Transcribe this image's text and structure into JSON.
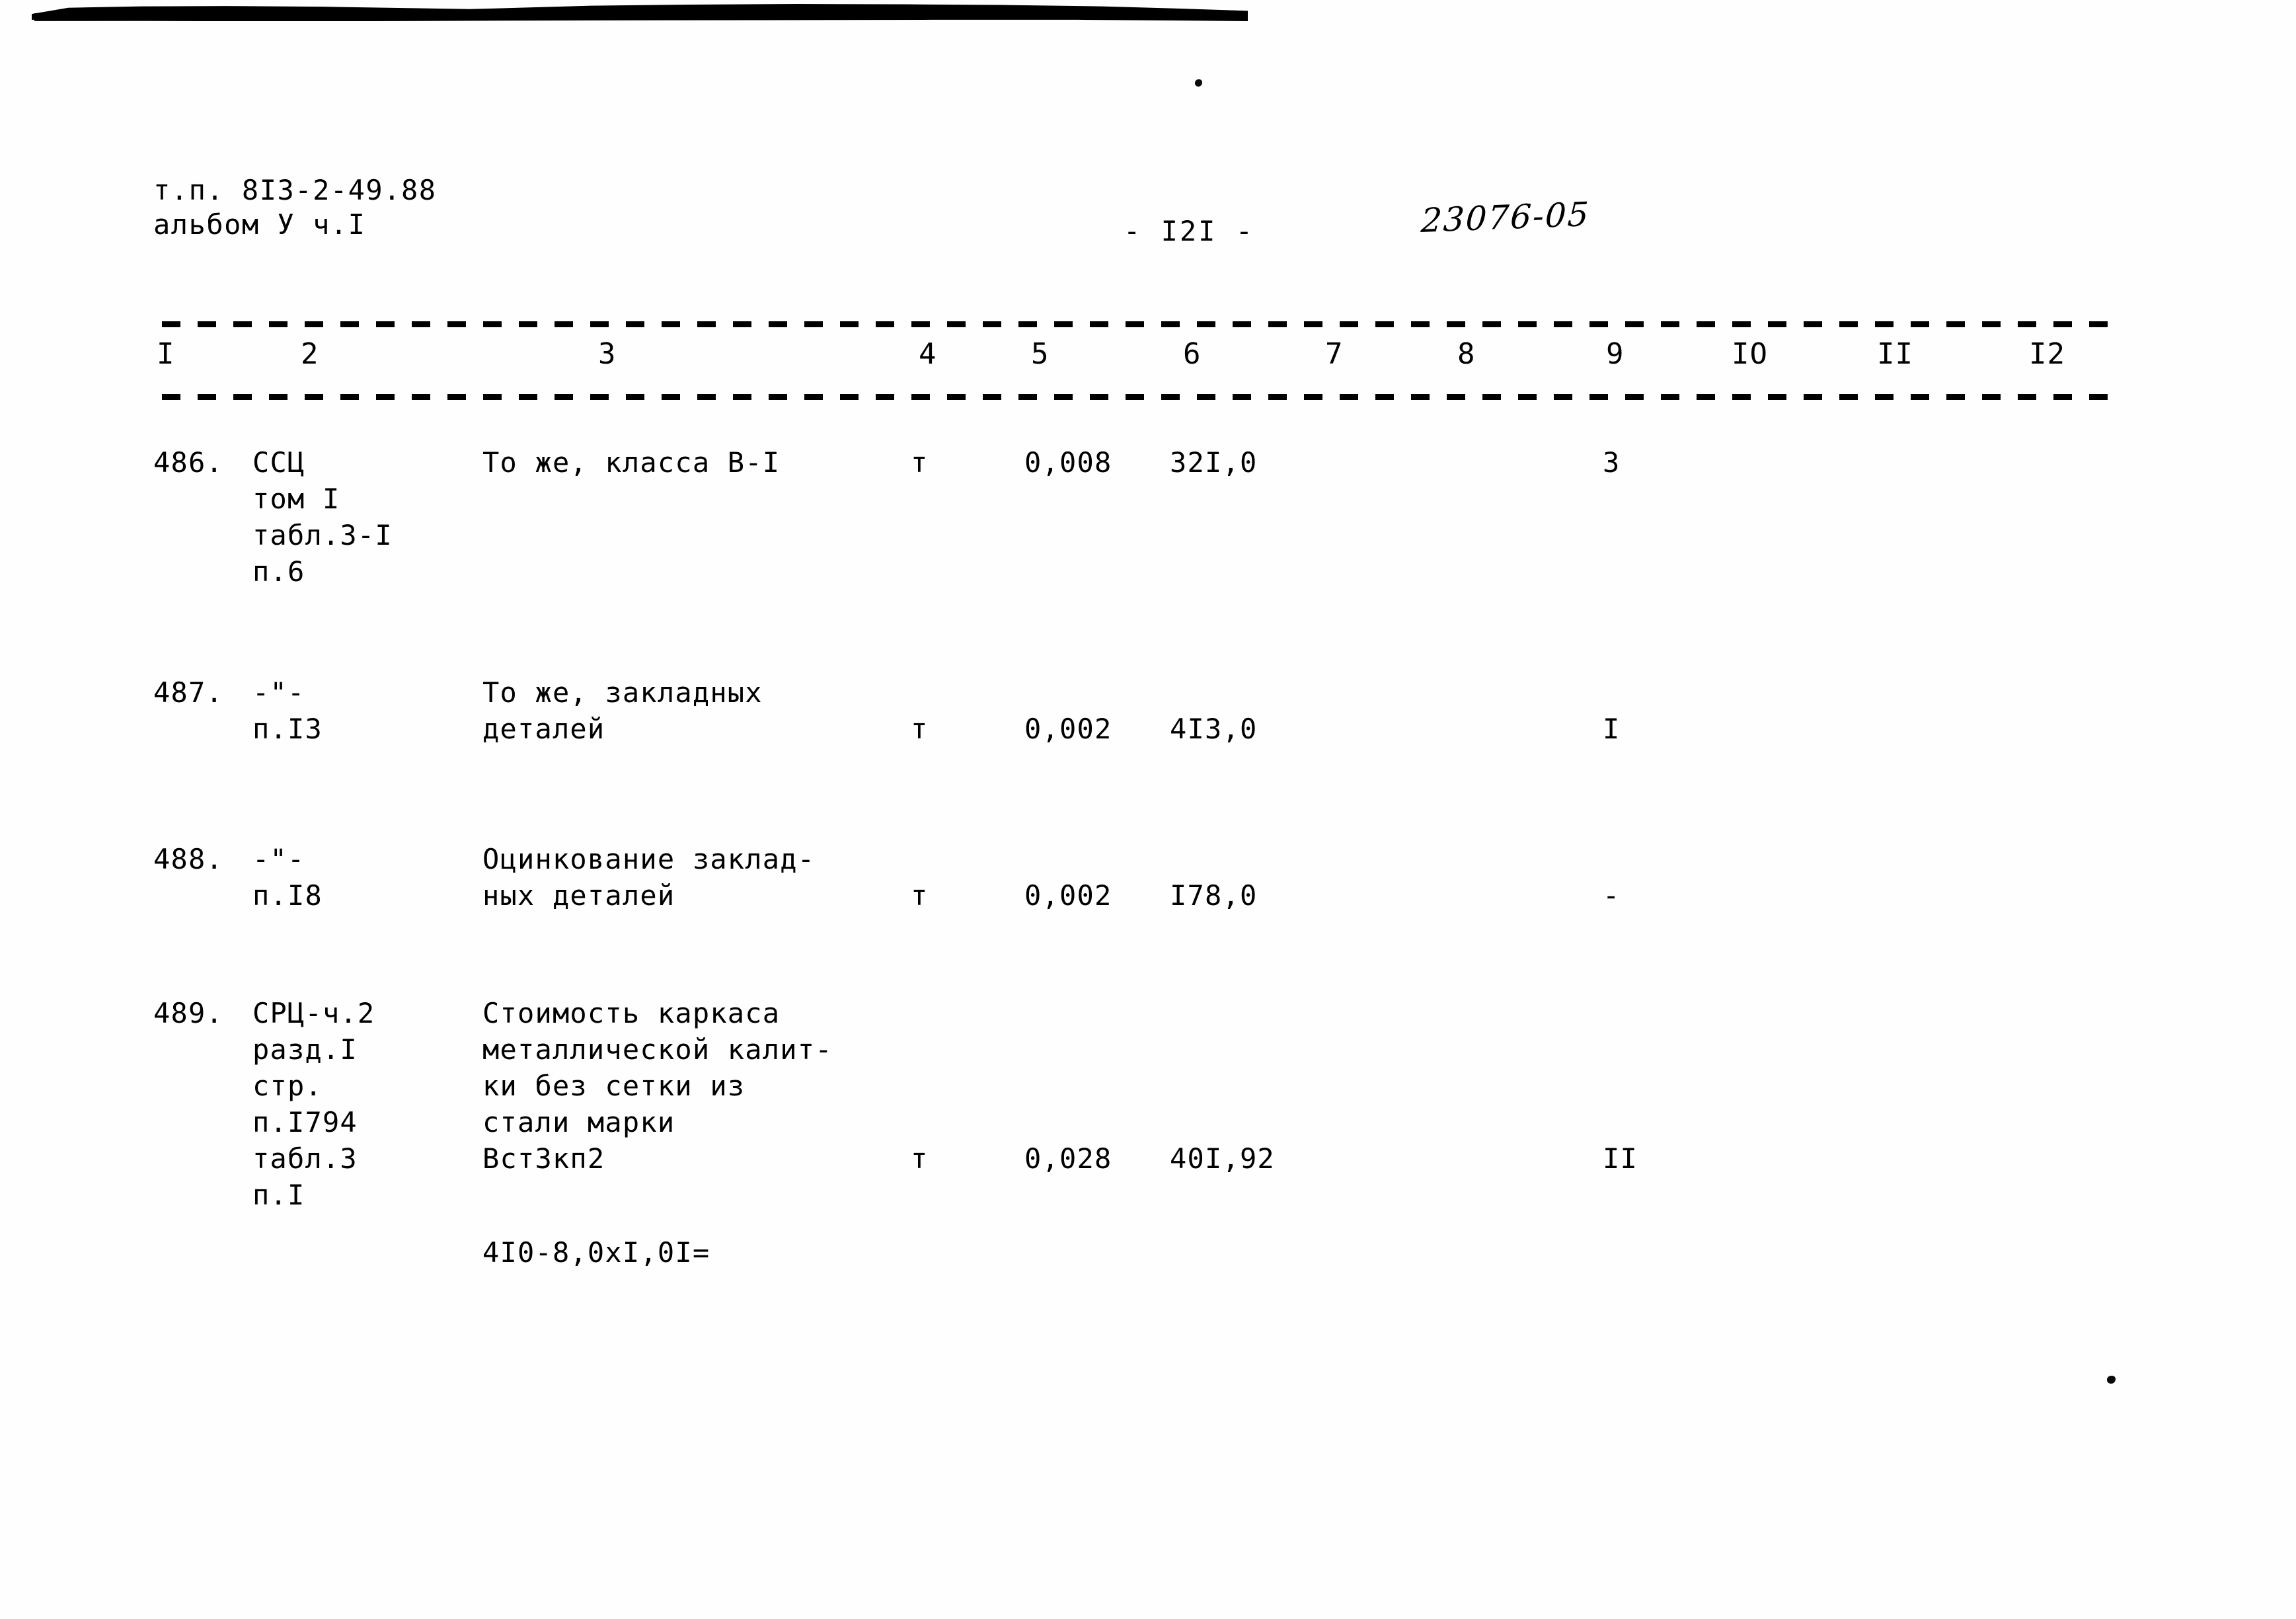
{
  "document": {
    "header_left": "т.п. 8I3-2-49.88\nальбом У ч.I",
    "page_marker": "- I2I -",
    "archive_stamp": "23076-05"
  },
  "table": {
    "column_headers": [
      "I",
      "2",
      "3",
      "4",
      "5",
      "6",
      "7",
      "8",
      "9",
      "IO",
      "II",
      "I2"
    ],
    "rows": [
      {
        "number": "486.",
        "reference": "ССЦ\nтом I\nтабл.3-I\nп.6",
        "description": "То же, класса В-I",
        "unit": "т",
        "quantity": "0,008",
        "price": "32I,0",
        "col9": "3"
      },
      {
        "number": "487.",
        "reference": "-\"-\nп.I3",
        "description": "То же, закладных\nдеталей",
        "unit": "т",
        "quantity": "0,002",
        "price": "4I3,0",
        "col9": "I"
      },
      {
        "number": "488.",
        "reference": "-\"-\nп.I8",
        "description": "Оцинкование заклад-\nных деталей",
        "unit": "т",
        "quantity": "0,002",
        "price": "I78,0",
        "col9": "-"
      },
      {
        "number": "489.",
        "reference": "СРЦ-ч.2\nразд.I\nстр.\nп.I794\nтабл.3\nп.I",
        "description": "Стоимость каркаса\nметаллической калит-\nки без сетки из\nстали марки\nВстЗкп2",
        "unit": "т",
        "quantity": "0,028",
        "price": "40I,92",
        "col9": "II"
      }
    ],
    "formula_note": "4I0-8,0xI,0I="
  }
}
